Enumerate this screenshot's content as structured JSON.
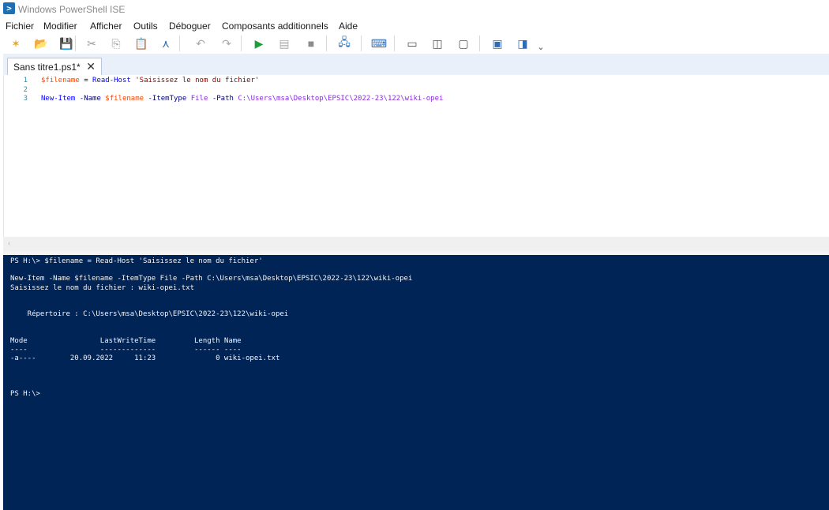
{
  "window": {
    "title": "Windows PowerShell ISE",
    "app_icon_glyph": ">"
  },
  "menu": [
    "Fichier",
    "Modifier",
    "Afficher",
    "Outils",
    "Déboguer",
    "Composants additionnels",
    "Aide"
  ],
  "toolbar": {
    "buttons": [
      {
        "name": "new-script-button",
        "glyph": "✶",
        "color": "#e7a52b"
      },
      {
        "name": "open-button",
        "glyph": "📂",
        "color": "#e8b547"
      },
      {
        "name": "save-button",
        "glyph": "💾",
        "color": "#2e6cb5"
      },
      {
        "name": "cut-button",
        "glyph": "✂",
        "color": "#9a9a9a"
      },
      {
        "name": "copy-button",
        "glyph": "⎘",
        "color": "#9a9a9a"
      },
      {
        "name": "paste-button",
        "glyph": "📋",
        "color": "#555555"
      },
      {
        "name": "clear-console-button",
        "glyph": "⋏",
        "color": "#2e6cb5"
      },
      {
        "name": "undo-button",
        "glyph": "↶",
        "color": "#a8a8a8"
      },
      {
        "name": "redo-button",
        "glyph": "↷",
        "color": "#a8a8a8"
      },
      {
        "name": "run-script-button",
        "glyph": "▶",
        "color": "#1e9e3a"
      },
      {
        "name": "run-selection-button",
        "glyph": "▤",
        "color": "#a8a8a8"
      },
      {
        "name": "stop-button",
        "glyph": "■",
        "color": "#8c8c8c"
      },
      {
        "name": "new-remote-tab-button",
        "glyph": "🖧",
        "color": "#2e6cb5"
      },
      {
        "name": "start-powershell-button",
        "glyph": "⌨",
        "color": "#2e6cb5"
      },
      {
        "name": "show-script-top-button",
        "glyph": "▭",
        "color": "#555555"
      },
      {
        "name": "show-script-right-button",
        "glyph": "◫",
        "color": "#555555"
      },
      {
        "name": "show-script-maximized-button",
        "glyph": "▢",
        "color": "#555555"
      },
      {
        "name": "show-commands-button",
        "glyph": "▣",
        "color": "#2e6cb5"
      },
      {
        "name": "show-addons-button",
        "glyph": "◨",
        "color": "#2e6cb5"
      },
      {
        "name": "customize-toolbar-button",
        "glyph": "⌄",
        "color": "#555555"
      }
    ]
  },
  "tab": {
    "label": "Sans titre1.ps1*",
    "close": "✕"
  },
  "editor": {
    "lines": [
      {
        "num": "1",
        "tokens": [
          {
            "t": "$filename",
            "c": "var"
          },
          {
            "t": " = ",
            "c": ""
          },
          {
            "t": "Read-Host",
            "c": "cmd"
          },
          {
            "t": " ",
            "c": ""
          },
          {
            "t": "'Saisissez le nom du fichier'",
            "c": "str"
          }
        ]
      },
      {
        "num": "2",
        "tokens": []
      },
      {
        "num": "3",
        "tokens": [
          {
            "t": "New-Item",
            "c": "cmd"
          },
          {
            "t": " ",
            "c": ""
          },
          {
            "t": "-Name",
            "c": "param"
          },
          {
            "t": " ",
            "c": ""
          },
          {
            "t": "$filename",
            "c": "var"
          },
          {
            "t": " ",
            "c": ""
          },
          {
            "t": "-ItemType",
            "c": "param"
          },
          {
            "t": " ",
            "c": ""
          },
          {
            "t": "File",
            "c": "arg"
          },
          {
            "t": " ",
            "c": ""
          },
          {
            "t": "-Path",
            "c": "param"
          },
          {
            "t": " ",
            "c": ""
          },
          {
            "t": "C:\\Users\\msa\\Desktop\\EPSIC\\2022-23\\122\\wiki-opei",
            "c": "arg"
          }
        ]
      }
    ]
  },
  "hscroll": {
    "left_arrow": "‹"
  },
  "console": {
    "lines": [
      "PS H:\\> $filename = Read-Host 'Saisissez le nom du fichier'",
      "",
      "New-Item -Name $filename -ItemType File -Path C:\\Users\\msa\\Desktop\\EPSIC\\2022-23\\122\\wiki-opei",
      "Saisissez le nom du fichier : wiki-opei.txt",
      "",
      "",
      "    Répertoire : C:\\Users\\msa\\Desktop\\EPSIC\\2022-23\\122\\wiki-opei",
      "",
      "",
      "Mode                 LastWriteTime         Length Name",
      "----                 -------------         ------ ----",
      "-a----        20.09.2022     11:23              0 wiki-opei.txt",
      "",
      "",
      "",
      "PS H:\\>"
    ]
  }
}
